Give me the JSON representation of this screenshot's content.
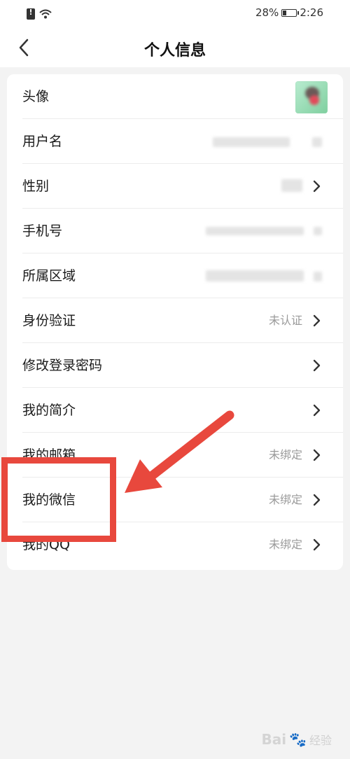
{
  "status_bar": {
    "battery": "28%",
    "time": "2:26"
  },
  "header": {
    "title": "个人信息",
    "back_icon": "chevron-left-icon"
  },
  "rows": [
    {
      "label": "头像",
      "value": "",
      "has_chevron": false
    },
    {
      "label": "用户名",
      "value": "",
      "has_chevron": false
    },
    {
      "label": "性别",
      "value": "",
      "has_chevron": true
    },
    {
      "label": "手机号",
      "value": "",
      "has_chevron": false
    },
    {
      "label": "所属区域",
      "value": "",
      "has_chevron": false
    },
    {
      "label": "身份验证",
      "value": "未认证",
      "has_chevron": true
    },
    {
      "label": "修改登录密码",
      "value": "",
      "has_chevron": true
    },
    {
      "label": "我的简介",
      "value": "",
      "has_chevron": true
    },
    {
      "label": "我的邮箱",
      "value": "未绑定",
      "has_chevron": true
    },
    {
      "label": "我的微信",
      "value": "未绑定",
      "has_chevron": true
    },
    {
      "label": "我的QQ",
      "value": "未绑定",
      "has_chevron": true
    }
  ],
  "annotation": {
    "color": "#e8483d"
  },
  "watermark": {
    "brand": "Bai",
    "sub": "经验"
  }
}
